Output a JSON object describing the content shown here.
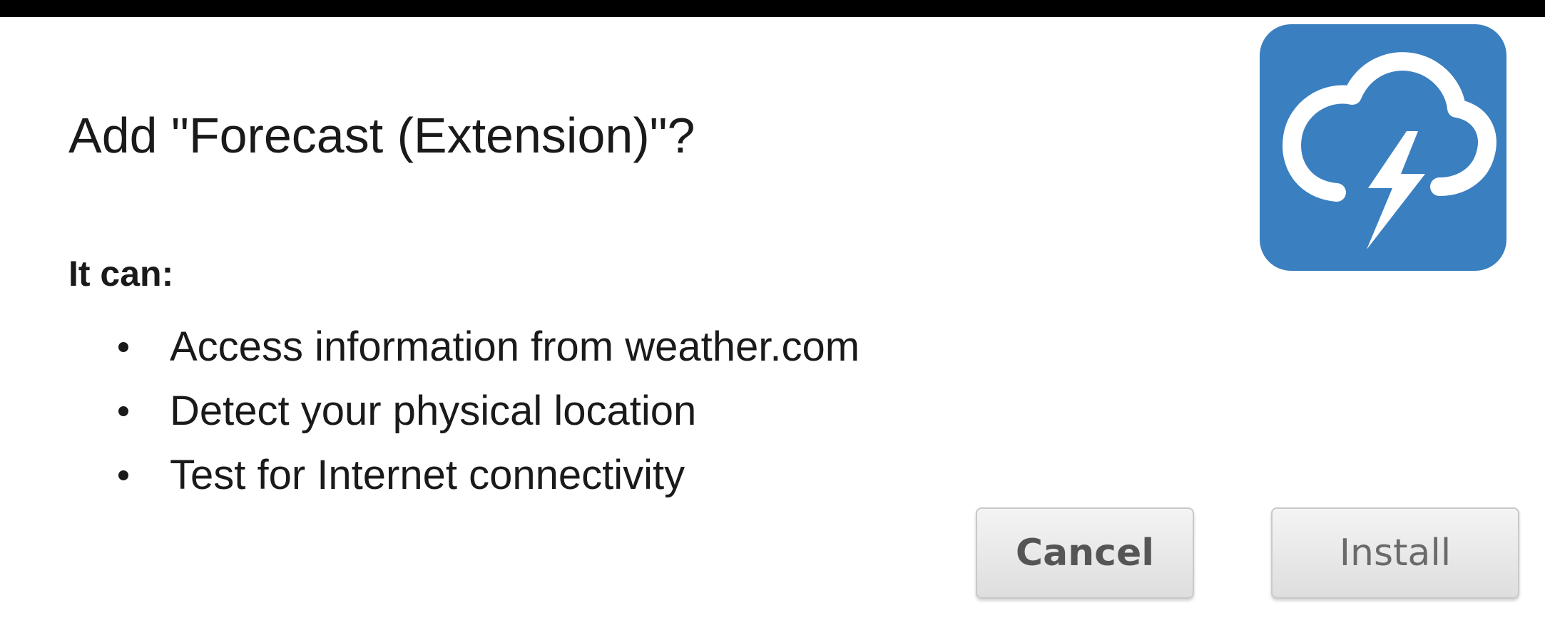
{
  "dialog": {
    "title": "Add \"Forecast (Extension)\"?",
    "permissions_heading": "It can:",
    "permissions": [
      "Access information from weather.com",
      "Detect your physical location",
      "Test for Internet connectivity"
    ],
    "icon": "forecast-cloud-lightning-icon",
    "cancel_label": "Cancel",
    "install_label": "Install"
  },
  "colors": {
    "background": "#000000",
    "dialog": "#ffffff",
    "icon_background": "#3a7fc0",
    "icon_foreground": "#ffffff",
    "button_text": "#555555"
  }
}
